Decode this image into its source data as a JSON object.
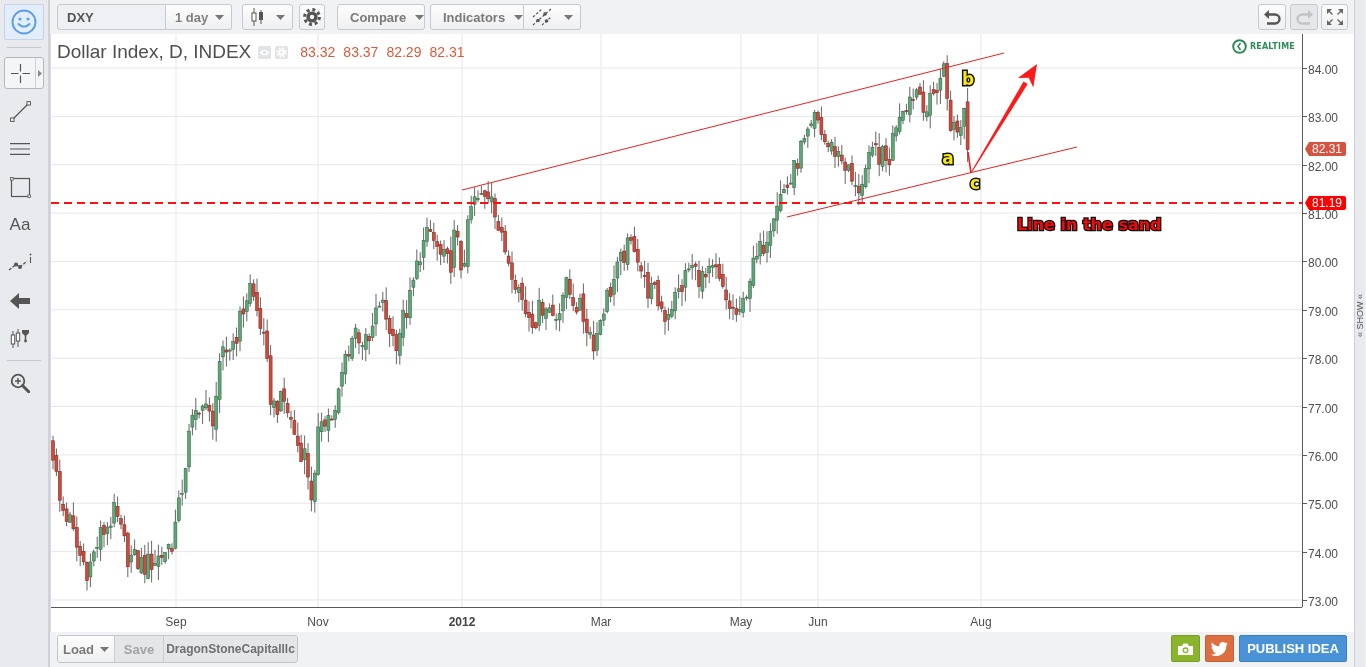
{
  "top_toolbar": {
    "symbol": "DXY",
    "interval": "1 day",
    "compare": "Compare",
    "indicators": "Indicators"
  },
  "history_buttons": [
    {
      "kind": "undo",
      "disabled": false
    },
    {
      "kind": "redo",
      "disabled": true
    }
  ],
  "drawing_tools": [
    {
      "kind": "crosshair",
      "selected": true
    },
    {
      "kind": "trend-line",
      "selected": false
    },
    {
      "kind": "horizontal-lines",
      "selected": false
    },
    {
      "kind": "rectangle",
      "selected": false
    },
    {
      "kind": "text",
      "label": "Aa",
      "selected": false
    },
    {
      "kind": "pattern",
      "selected": false
    },
    {
      "kind": "arrow",
      "selected": false
    },
    {
      "kind": "fork",
      "selected": false
    },
    {
      "kind": "zoom",
      "selected": false
    }
  ],
  "legend": {
    "title": "Dollar Index, D, INDEX",
    "values": [
      "83.32",
      "83.37",
      "82.29",
      "82.31"
    ]
  },
  "realtime": "REALTIME",
  "price_axis": [
    "84.00",
    "83.00",
    "82.00",
    "81.00",
    "80.00",
    "79.00",
    "78.00",
    "77.00",
    "76.00",
    "75.00",
    "74.00",
    "73.00"
  ],
  "price_tags": [
    {
      "text": "82.31",
      "color": "#d5533f"
    },
    {
      "text": "81.19",
      "color": "#ff0000"
    }
  ],
  "time_axis": [
    {
      "text": "Sep",
      "kind": "month"
    },
    {
      "text": "Nov",
      "kind": "month"
    },
    {
      "text": "2012",
      "kind": "year"
    },
    {
      "text": "Mar",
      "kind": "month"
    },
    {
      "text": "May",
      "kind": "month"
    },
    {
      "text": "Jun",
      "kind": "month"
    },
    {
      "text": "Aug",
      "kind": "month"
    }
  ],
  "annotations": [
    {
      "kind": "wave",
      "text": "a"
    },
    {
      "kind": "wave",
      "text": "b"
    },
    {
      "kind": "wave",
      "text": "c"
    },
    {
      "kind": "note",
      "text": "Line in the sand"
    }
  ],
  "side_panel": {
    "label": "« SHOW «"
  },
  "bottom_bar": {
    "load": "Load",
    "save": {
      "label": "Save",
      "disabled": true
    },
    "layout_name": "DragonStoneCapitalllc",
    "publish": "PUBLISH IDEA"
  }
}
